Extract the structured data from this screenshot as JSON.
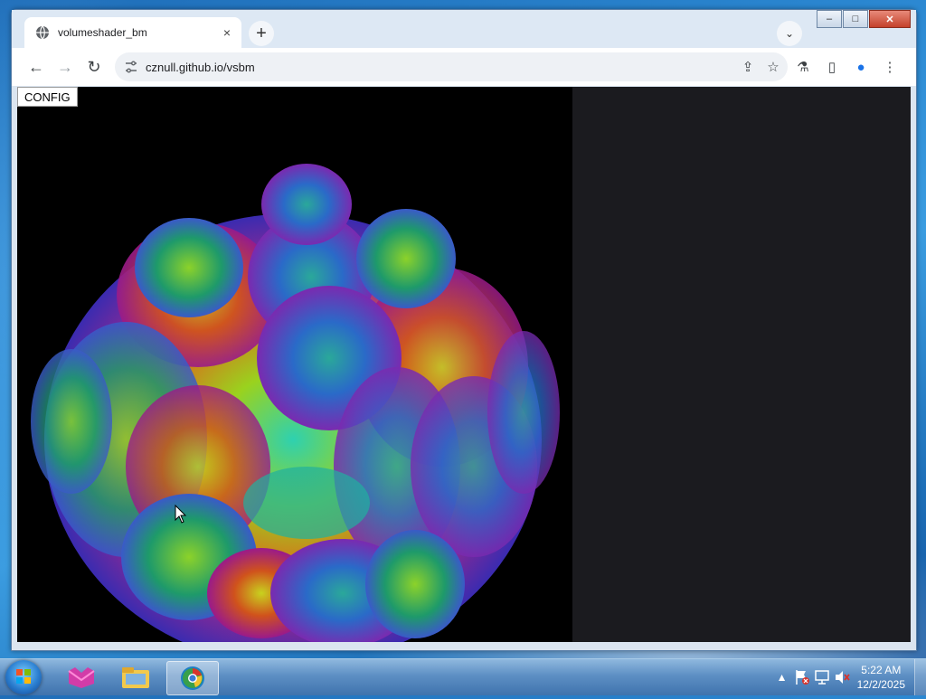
{
  "browser": {
    "tab": {
      "title": "volumeshader_bm",
      "favicon": "globe-icon",
      "close_label": "×"
    },
    "new_tab_label": "+",
    "tab_search_label": "⌄",
    "window_controls": {
      "minimize": "–",
      "maximize": "□",
      "close": "✕"
    },
    "nav": {
      "back": "←",
      "forward": "→",
      "reload": "↻"
    },
    "omnibox": {
      "url": "cznull.github.io/vsbm",
      "site_info_icon": "tune-icon"
    },
    "omni_actions": {
      "share": "⇪",
      "bookmark": "☆"
    },
    "toolbar_icons": {
      "labs": "⚗",
      "side_panel": "▯",
      "profile": "●",
      "menu": "⋮"
    }
  },
  "page": {
    "config_label": "CONFIG",
    "render_description": "fractal"
  },
  "taskbar": {
    "apps": [
      "start-orb",
      "kitty-app",
      "file-explorer",
      "chrome-browser"
    ],
    "clock": {
      "time": "5:22 AM",
      "date": "12/2/2025"
    },
    "tray_arrow": "▲"
  }
}
